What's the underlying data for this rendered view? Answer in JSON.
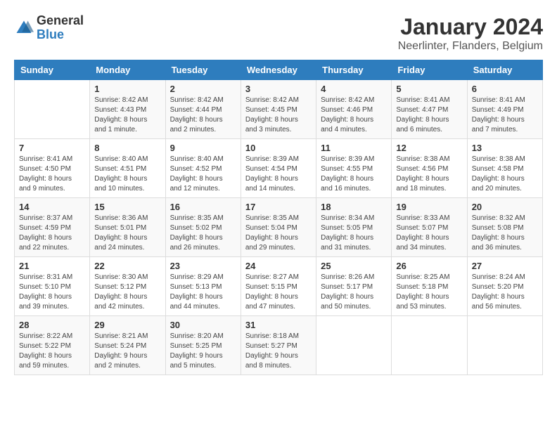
{
  "header": {
    "logo_general": "General",
    "logo_blue": "Blue",
    "main_title": "January 2024",
    "subtitle": "Neerlinter, Flanders, Belgium"
  },
  "calendar": {
    "days_of_week": [
      "Sunday",
      "Monday",
      "Tuesday",
      "Wednesday",
      "Thursday",
      "Friday",
      "Saturday"
    ],
    "weeks": [
      [
        {
          "day": "",
          "info": ""
        },
        {
          "day": "1",
          "info": "Sunrise: 8:42 AM\nSunset: 4:43 PM\nDaylight: 8 hours\nand 1 minute."
        },
        {
          "day": "2",
          "info": "Sunrise: 8:42 AM\nSunset: 4:44 PM\nDaylight: 8 hours\nand 2 minutes."
        },
        {
          "day": "3",
          "info": "Sunrise: 8:42 AM\nSunset: 4:45 PM\nDaylight: 8 hours\nand 3 minutes."
        },
        {
          "day": "4",
          "info": "Sunrise: 8:42 AM\nSunset: 4:46 PM\nDaylight: 8 hours\nand 4 minutes."
        },
        {
          "day": "5",
          "info": "Sunrise: 8:41 AM\nSunset: 4:47 PM\nDaylight: 8 hours\nand 6 minutes."
        },
        {
          "day": "6",
          "info": "Sunrise: 8:41 AM\nSunset: 4:49 PM\nDaylight: 8 hours\nand 7 minutes."
        }
      ],
      [
        {
          "day": "7",
          "info": "Sunrise: 8:41 AM\nSunset: 4:50 PM\nDaylight: 8 hours\nand 9 minutes."
        },
        {
          "day": "8",
          "info": "Sunrise: 8:40 AM\nSunset: 4:51 PM\nDaylight: 8 hours\nand 10 minutes."
        },
        {
          "day": "9",
          "info": "Sunrise: 8:40 AM\nSunset: 4:52 PM\nDaylight: 8 hours\nand 12 minutes."
        },
        {
          "day": "10",
          "info": "Sunrise: 8:39 AM\nSunset: 4:54 PM\nDaylight: 8 hours\nand 14 minutes."
        },
        {
          "day": "11",
          "info": "Sunrise: 8:39 AM\nSunset: 4:55 PM\nDaylight: 8 hours\nand 16 minutes."
        },
        {
          "day": "12",
          "info": "Sunrise: 8:38 AM\nSunset: 4:56 PM\nDaylight: 8 hours\nand 18 minutes."
        },
        {
          "day": "13",
          "info": "Sunrise: 8:38 AM\nSunset: 4:58 PM\nDaylight: 8 hours\nand 20 minutes."
        }
      ],
      [
        {
          "day": "14",
          "info": "Sunrise: 8:37 AM\nSunset: 4:59 PM\nDaylight: 8 hours\nand 22 minutes."
        },
        {
          "day": "15",
          "info": "Sunrise: 8:36 AM\nSunset: 5:01 PM\nDaylight: 8 hours\nand 24 minutes."
        },
        {
          "day": "16",
          "info": "Sunrise: 8:35 AM\nSunset: 5:02 PM\nDaylight: 8 hours\nand 26 minutes."
        },
        {
          "day": "17",
          "info": "Sunrise: 8:35 AM\nSunset: 5:04 PM\nDaylight: 8 hours\nand 29 minutes."
        },
        {
          "day": "18",
          "info": "Sunrise: 8:34 AM\nSunset: 5:05 PM\nDaylight: 8 hours\nand 31 minutes."
        },
        {
          "day": "19",
          "info": "Sunrise: 8:33 AM\nSunset: 5:07 PM\nDaylight: 8 hours\nand 34 minutes."
        },
        {
          "day": "20",
          "info": "Sunrise: 8:32 AM\nSunset: 5:08 PM\nDaylight: 8 hours\nand 36 minutes."
        }
      ],
      [
        {
          "day": "21",
          "info": "Sunrise: 8:31 AM\nSunset: 5:10 PM\nDaylight: 8 hours\nand 39 minutes."
        },
        {
          "day": "22",
          "info": "Sunrise: 8:30 AM\nSunset: 5:12 PM\nDaylight: 8 hours\nand 42 minutes."
        },
        {
          "day": "23",
          "info": "Sunrise: 8:29 AM\nSunset: 5:13 PM\nDaylight: 8 hours\nand 44 minutes."
        },
        {
          "day": "24",
          "info": "Sunrise: 8:27 AM\nSunset: 5:15 PM\nDaylight: 8 hours\nand 47 minutes."
        },
        {
          "day": "25",
          "info": "Sunrise: 8:26 AM\nSunset: 5:17 PM\nDaylight: 8 hours\nand 50 minutes."
        },
        {
          "day": "26",
          "info": "Sunrise: 8:25 AM\nSunset: 5:18 PM\nDaylight: 8 hours\nand 53 minutes."
        },
        {
          "day": "27",
          "info": "Sunrise: 8:24 AM\nSunset: 5:20 PM\nDaylight: 8 hours\nand 56 minutes."
        }
      ],
      [
        {
          "day": "28",
          "info": "Sunrise: 8:22 AM\nSunset: 5:22 PM\nDaylight: 8 hours\nand 59 minutes."
        },
        {
          "day": "29",
          "info": "Sunrise: 8:21 AM\nSunset: 5:24 PM\nDaylight: 9 hours\nand 2 minutes."
        },
        {
          "day": "30",
          "info": "Sunrise: 8:20 AM\nSunset: 5:25 PM\nDaylight: 9 hours\nand 5 minutes."
        },
        {
          "day": "31",
          "info": "Sunrise: 8:18 AM\nSunset: 5:27 PM\nDaylight: 9 hours\nand 8 minutes."
        },
        {
          "day": "",
          "info": ""
        },
        {
          "day": "",
          "info": ""
        },
        {
          "day": "",
          "info": ""
        }
      ]
    ]
  }
}
